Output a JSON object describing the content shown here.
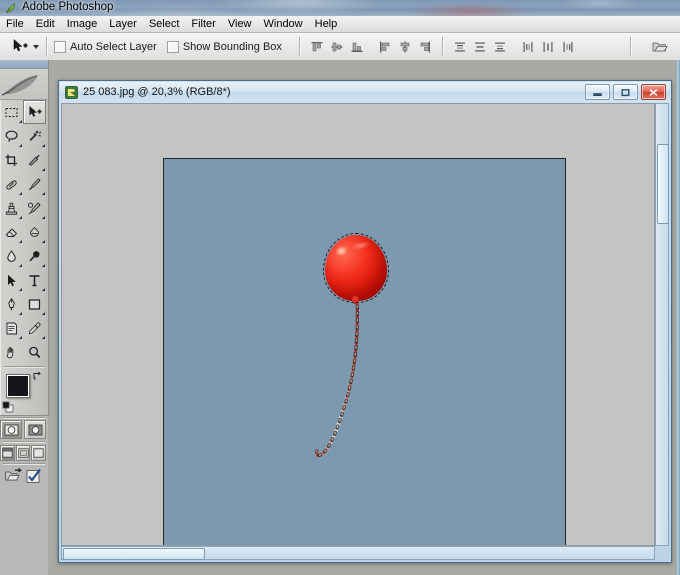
{
  "app": {
    "title": "Adobe Photoshop",
    "icon": "photoshop-feather-icon"
  },
  "menubar": {
    "items": [
      {
        "label": "File"
      },
      {
        "label": "Edit"
      },
      {
        "label": "Image"
      },
      {
        "label": "Layer"
      },
      {
        "label": "Select"
      },
      {
        "label": "Filter"
      },
      {
        "label": "View"
      },
      {
        "label": "Window"
      },
      {
        "label": "Help"
      }
    ]
  },
  "options_bar": {
    "active_tool": "move-tool",
    "auto_select_layer": {
      "label": "Auto Select Layer",
      "checked": false
    },
    "show_bounding_box": {
      "label": "Show Bounding Box",
      "checked": false
    },
    "align_buttons": [
      {
        "name": "align-top-edges"
      },
      {
        "name": "align-vertical-centers"
      },
      {
        "name": "align-bottom-edges"
      },
      {
        "name": "align-left-edges"
      },
      {
        "name": "align-horizontal-centers"
      },
      {
        "name": "align-right-edges"
      }
    ],
    "distribute_buttons": [
      {
        "name": "distribute-top-edges"
      },
      {
        "name": "distribute-vertical-centers"
      },
      {
        "name": "distribute-bottom-edges"
      },
      {
        "name": "distribute-left-edges"
      },
      {
        "name": "distribute-horizontal-centers"
      },
      {
        "name": "distribute-right-edges"
      }
    ],
    "palette_well": {
      "name": "palette-well-icon"
    }
  },
  "toolbox": {
    "tools": [
      {
        "name": "rectangular-marquee-tool",
        "selected": false,
        "has_flyout": true
      },
      {
        "name": "move-tool",
        "selected": true,
        "has_flyout": false
      },
      {
        "name": "lasso-tool",
        "selected": false,
        "has_flyout": true
      },
      {
        "name": "magic-wand-tool",
        "selected": false,
        "has_flyout": true
      },
      {
        "name": "crop-tool",
        "selected": false,
        "has_flyout": false
      },
      {
        "name": "slice-tool",
        "selected": false,
        "has_flyout": true
      },
      {
        "name": "healing-brush-tool",
        "selected": false,
        "has_flyout": true
      },
      {
        "name": "brush-tool",
        "selected": false,
        "has_flyout": true
      },
      {
        "name": "clone-stamp-tool",
        "selected": false,
        "has_flyout": true
      },
      {
        "name": "history-brush-tool",
        "selected": false,
        "has_flyout": true
      },
      {
        "name": "eraser-tool",
        "selected": false,
        "has_flyout": true
      },
      {
        "name": "gradient-tool",
        "selected": false,
        "has_flyout": true
      },
      {
        "name": "blur-tool",
        "selected": false,
        "has_flyout": true
      },
      {
        "name": "dodge-tool",
        "selected": false,
        "has_flyout": true
      },
      {
        "name": "path-selection-tool",
        "selected": false,
        "has_flyout": true
      },
      {
        "name": "type-tool",
        "selected": false,
        "has_flyout": true
      },
      {
        "name": "pen-tool",
        "selected": false,
        "has_flyout": true
      },
      {
        "name": "rectangle-shape-tool",
        "selected": false,
        "has_flyout": true
      },
      {
        "name": "notes-tool",
        "selected": false,
        "has_flyout": true
      },
      {
        "name": "eyedropper-tool",
        "selected": false,
        "has_flyout": true
      },
      {
        "name": "hand-tool",
        "selected": false,
        "has_flyout": false
      },
      {
        "name": "zoom-tool",
        "selected": false,
        "has_flyout": false
      }
    ],
    "colors": {
      "foreground": "#14161c",
      "background": "#d6d2cc",
      "swap_icon": "swap-colors-icon",
      "default_icon": "default-colors-icon"
    },
    "mask_modes": [
      {
        "name": "standard-mask-mode-button",
        "active": true
      },
      {
        "name": "quick-mask-mode-button",
        "active": false
      }
    ],
    "screen_modes": [
      {
        "name": "standard-screen-mode-button",
        "active": true
      },
      {
        "name": "full-screen-with-menubar-button",
        "active": false
      },
      {
        "name": "full-screen-mode-button",
        "active": false
      }
    ],
    "jump_to": [
      {
        "name": "jump-to-imageready-icon"
      },
      {
        "name": "jump-to-check-icon"
      }
    ]
  },
  "document": {
    "title": "25 083.jpg @ 20,3% (RGB/8*)",
    "filename": "25 083.jpg",
    "zoom": "20,3%",
    "color_mode": "RGB/8*",
    "icon": "document-image-icon",
    "window_buttons": [
      {
        "name": "minimize-button",
        "glyph": "minimize"
      },
      {
        "name": "maximize-button",
        "glyph": "maximize"
      },
      {
        "name": "close-button",
        "glyph": "close"
      }
    ],
    "canvas": {
      "sky_color": "#7d99b0",
      "border_color": "#1e2630",
      "content": "red-balloon-with-striped-ribbon",
      "selection": "marching-ants-around-balloon",
      "balloon_color": "#e8251a"
    },
    "scrollbars": {
      "vertical": "document-vertical-scrollbar",
      "horizontal": "document-horizontal-scrollbar"
    }
  }
}
